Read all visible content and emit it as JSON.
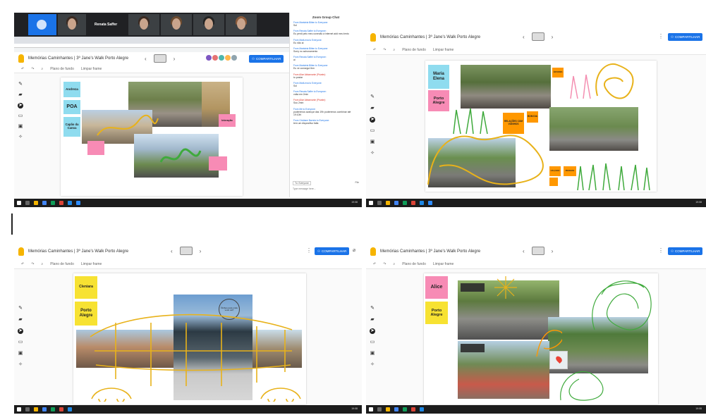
{
  "board": {
    "title": "Memórias Caminhantes | 3º Jane's Walk Porto Alegre",
    "share_label": "COMPARTILHAR",
    "background_label": "Plano de fundo",
    "clear_label": "Limpar frame",
    "prev_icon": "chevron-left-icon",
    "next_icon": "chevron-right-icon"
  },
  "meeting": {
    "participant_name": "Renata Saffer",
    "participants": [
      "",
      "Renata Saffer",
      "",
      "",
      "",
      ""
    ]
  },
  "chat": {
    "title": "Zoom Group Chat",
    "messages": [
      {
        "from": "From Maristela Bitten to Everyone:",
        "text": "Sol",
        "private": false
      },
      {
        "from": "From Renata Saffer to Everyone:",
        "text": "Eu perdi pelo meu conexão à internet add meu lento",
        "private": false
      },
      {
        "from": "From MariLena to Everyone:",
        "text": "Eu não ai",
        "private": false
      },
      {
        "from": "From Maristela Bitten to Everyone:",
        "text": "Sorry no achonamento",
        "private": false
      },
      {
        "from": "From Renata Saffer to Everyone:",
        "text": "ai",
        "private": false
      },
      {
        "from": "From Maristela Bitten to Everyone:",
        "text": "Eu ve consegui tbm",
        "private": false
      },
      {
        "from": "From Alice Abbamonte (Private):",
        "text": "to postar",
        "private": true
      },
      {
        "from": "From MariLena to Everyone:",
        "text": "Sol",
        "private": false
      },
      {
        "from": "From Renata Saffer to Everyone:",
        "text": "volta em 2min",
        "private": false
      },
      {
        "from": "From Alice Abbamonte (Private):",
        "text": "Sou 2min",
        "private": true
      },
      {
        "from": "From Me to Everyone:",
        "text": "poderemos avançar das 19h poderemos combinar até 19:10h!",
        "private": false
      },
      {
        "from": "From Cristiane Barreto to Everyone:",
        "text": "tem um dispositivo falta",
        "private": false
      }
    ],
    "to_label": "To: Everyone",
    "file_label": "File",
    "placeholder": "Type message here..."
  },
  "panel1_notes": {
    "andreza": "Andreza",
    "poa": "POA",
    "capao": "Capão da Canoa",
    "interacao": "Interação"
  },
  "panel2_notes": {
    "maria_elena": "Maria Elena",
    "porto_alegre": "Porto Alegre",
    "relacoes": "RELAÇÕES COM VIZINHOS",
    "bom_dia": "BOM DIA",
    "small1": "ÁRVORES",
    "small2": "CALÇADA",
    "small3": "PESSOAS"
  },
  "panel3_notes": {
    "cleniara": "Cleniara",
    "porto_alegre": "Porto Alegre",
    "bubble": "Ônibus para onde você vai?"
  },
  "panel4_notes": {
    "alice": "Alice",
    "porto_alegre": "Porto Alegre"
  },
  "colors": {
    "cyan_note": "#8fdcef",
    "pink_note": "#f78bb5",
    "yellow_note": "#f7e232",
    "orange_note": "#ff9800",
    "scribble_yellow": "#e8b21a",
    "scribble_green": "#3faa3c",
    "share_blue": "#1a73e8"
  },
  "icons": {
    "pen": "pen-icon",
    "eraser": "eraser-icon",
    "select": "cursor-icon",
    "sticky": "sticky-note-icon",
    "image": "image-icon",
    "laser": "laser-icon",
    "undo": "undo-icon",
    "redo": "redo-icon",
    "zoom": "zoom-icon"
  },
  "taskbar": {
    "clock": "19:08"
  }
}
